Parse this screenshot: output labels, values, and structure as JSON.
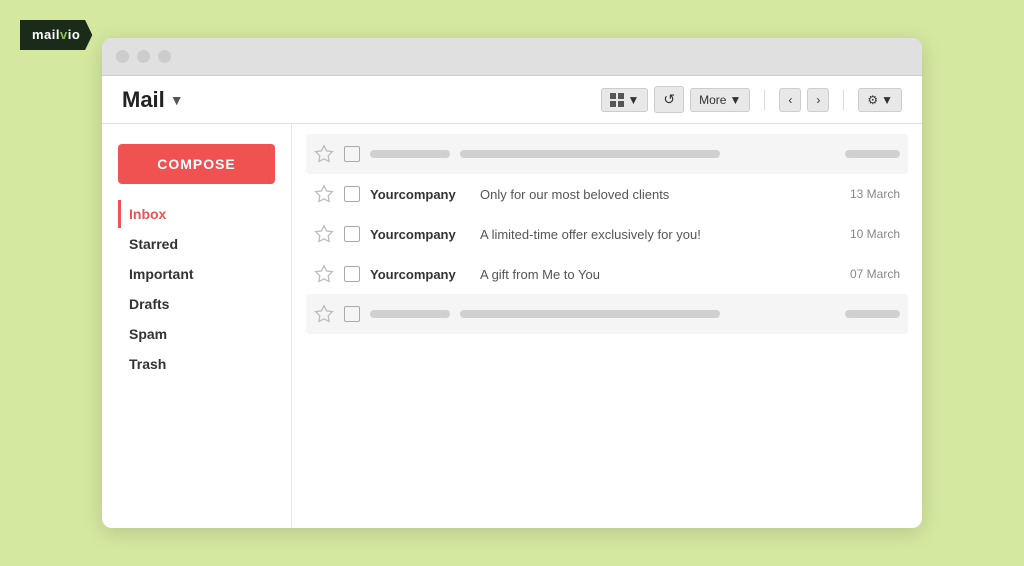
{
  "logo": {
    "text_part1": "mail",
    "text_part2": "v",
    "text_part3": "io"
  },
  "browser": {
    "traffic_lights": [
      "circle1",
      "circle2",
      "circle3"
    ]
  },
  "toolbar": {
    "title": "Mail",
    "title_chevron": "▼",
    "btn_grid_label": "▼",
    "btn_refresh_label": "↺",
    "btn_more_label": "More",
    "btn_more_chevron": "▼",
    "btn_prev_label": "‹",
    "btn_next_label": "›",
    "btn_settings_label": "⚙",
    "btn_settings_chevron": "▼"
  },
  "sidebar": {
    "compose_label": "COMPOSE",
    "nav_items": [
      {
        "id": "inbox",
        "label": "Inbox",
        "active": true
      },
      {
        "id": "starred",
        "label": "Starred",
        "active": false
      },
      {
        "id": "important",
        "label": "Important",
        "active": false
      },
      {
        "id": "drafts",
        "label": "Drafts",
        "active": false
      },
      {
        "id": "spam",
        "label": "Spam",
        "active": false
      },
      {
        "id": "trash",
        "label": "Trash",
        "active": false
      }
    ]
  },
  "emails": {
    "rows": [
      {
        "id": "row1",
        "type": "placeholder",
        "sender": "",
        "subject": "",
        "date": ""
      },
      {
        "id": "row2",
        "type": "real",
        "sender": "Yourcompany",
        "subject": "Only for our most beloved clients",
        "date": "13 March"
      },
      {
        "id": "row3",
        "type": "real",
        "sender": "Yourcompany",
        "subject": "A limited-time offer exclusively for you!",
        "date": "10 March"
      },
      {
        "id": "row4",
        "type": "real",
        "sender": "Yourcompany",
        "subject": "A gift from Me to You",
        "date": "07 March"
      },
      {
        "id": "row5",
        "type": "placeholder",
        "sender": "",
        "subject": "",
        "date": ""
      }
    ]
  }
}
